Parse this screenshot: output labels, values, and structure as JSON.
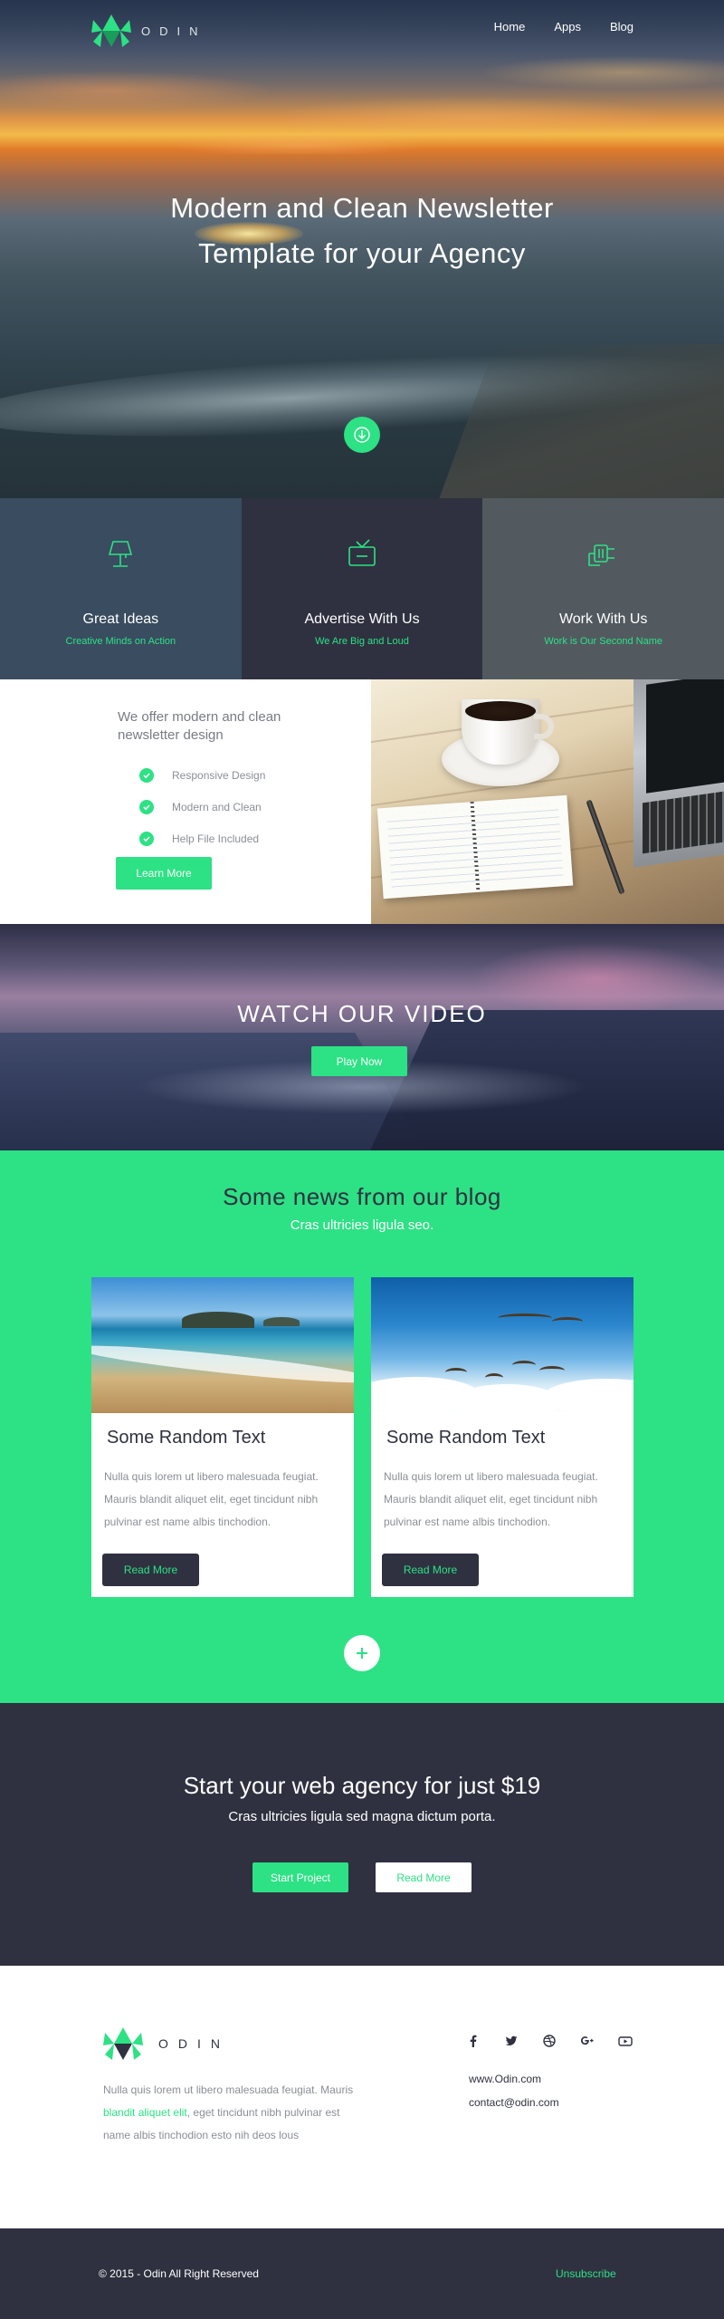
{
  "colors": {
    "accent": "#2de185",
    "dark": "#2f3140",
    "feature_1": "#3a4c5f",
    "feature_2": "#2f3140",
    "feature_3": "#525a60"
  },
  "header": {
    "logo_text": "ODIN",
    "nav": [
      "Home",
      "Apps",
      "Blog"
    ]
  },
  "hero": {
    "title_line1": "Modern and Clean Newsletter",
    "title_line2": "Template for your Agency",
    "scroll_icon": "arrow-down-icon"
  },
  "features": [
    {
      "icon": "lamp-icon",
      "title": "Great Ideas",
      "subtitle": "Creative Minds on Action"
    },
    {
      "icon": "tv-icon",
      "title": "Advertise With Us",
      "subtitle": "We Are Big and Loud"
    },
    {
      "icon": "plug-icon",
      "title": "Work With Us",
      "subtitle": "Work is Our Second Name"
    }
  ],
  "offer": {
    "heading": "We offer modern and clean newsletter design",
    "items": [
      "Responsive Design",
      "Modern and Clean",
      "Help File Included"
    ],
    "button": "Learn More"
  },
  "video": {
    "title": "WATCH OUR VIDEO",
    "button": "Play Now"
  },
  "blog": {
    "title": "Some news from our blog",
    "subtitle": "Cras ultricies ligula seo.",
    "posts": [
      {
        "title": "Some Random Text",
        "text": "Nulla quis lorem ut libero malesuada feugiat. Mauris blandit aliquet elit, eget tincidunt nibh pulvinar est name albis tinchodion.",
        "button": "Read More"
      },
      {
        "title": "Some Random Text",
        "text": "Nulla quis lorem ut libero malesuada feugiat. Mauris blandit aliquet elit, eget tincidunt nibh pulvinar est name albis tinchodion.",
        "button": "Read More"
      }
    ],
    "more_icon": "plus-icon"
  },
  "cta": {
    "title": "Start your web agency for just $19",
    "subtitle": "Cras ultricies ligula sed magna dictum porta.",
    "primary": "Start Project",
    "secondary": "Read More"
  },
  "footer": {
    "logo_text": "ODIN",
    "text_before": "Nulla quis lorem ut libero malesuada feugiat. Mauris ",
    "text_link": "blandit aliquet elit",
    "text_after": ", eget tincidunt nibh pulvinar est name albis tinchodion esto nih deos lous",
    "socials": [
      "facebook-icon",
      "twitter-icon",
      "dribbble-icon",
      "google-plus-icon",
      "youtube-icon"
    ],
    "website": "www.Odin.com",
    "email": "contact@odin.com"
  },
  "bottom": {
    "copyright": "© 2015 - Odin All Right Reserved",
    "unsubscribe": "Unsubscribe"
  }
}
